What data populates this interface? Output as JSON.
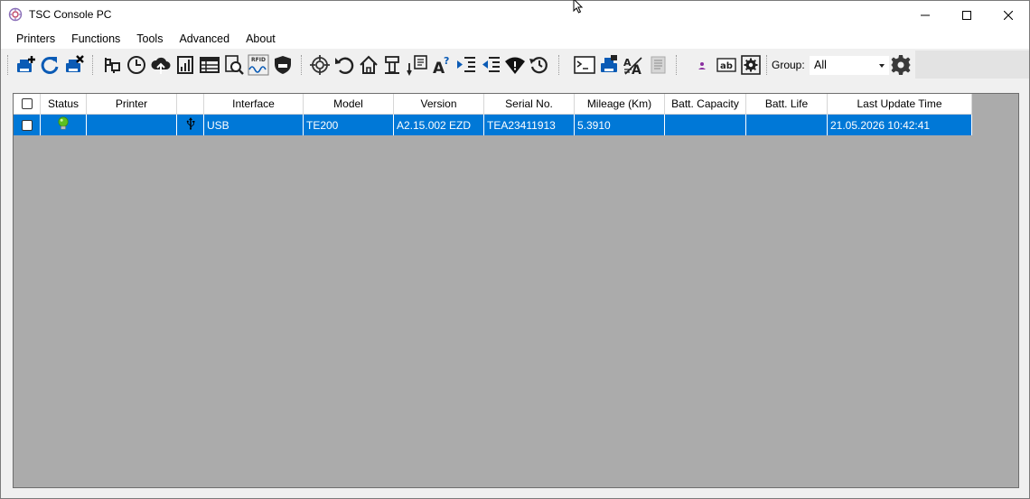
{
  "window": {
    "title": "TSC Console PC"
  },
  "menu": [
    "Printers",
    "Functions",
    "Tools",
    "Advanced",
    "About"
  ],
  "toolbar": {
    "group_label": "Group:",
    "group_value": "All",
    "buttons": [
      "add-printer-icon",
      "refresh-icon",
      "remove-printer-icon",
      "printer-config-icon",
      "clock-icon",
      "cloud-upload-icon",
      "bar-chart-icon",
      "table-icon",
      "search-document-icon",
      "rfid-icon",
      "shield-icon",
      "crosshair-icon",
      "undo-icon",
      "home-icon",
      "feed-icon",
      "calibrate-icon",
      "font-icon",
      "list-indent-icon",
      "list-outdent-icon",
      "wifi-icon",
      "history-icon",
      "terminal-icon",
      "print-queue-icon",
      "text-resize-icon",
      "label-icon",
      "user-icon",
      "ab-label-icon",
      "settings-box-icon",
      "gear-icon"
    ]
  },
  "table": {
    "headers": [
      "",
      "Status",
      "Printer",
      "",
      "Interface",
      "Model",
      "Version",
      "Serial No.",
      "Mileage (Km)",
      "Batt. Capacity",
      "Batt. Life",
      "Last Update Time"
    ],
    "rows": [
      {
        "checked": false,
        "status": "online",
        "printer": "",
        "interface_icon": "usb-icon",
        "interface": "USB",
        "model": "TE200",
        "version": "A2.15.002 EZD",
        "serial": "TEA23411913",
        "mileage": "5.3910",
        "batt_capacity": "",
        "batt_life": "",
        "last_update": "21.05.2026 10:42:41"
      }
    ]
  },
  "colors": {
    "selection": "#0078d7",
    "panel_bg": "#ababab",
    "toolbar_blue": "#0b5bb5",
    "status_green": "#5cc021"
  }
}
